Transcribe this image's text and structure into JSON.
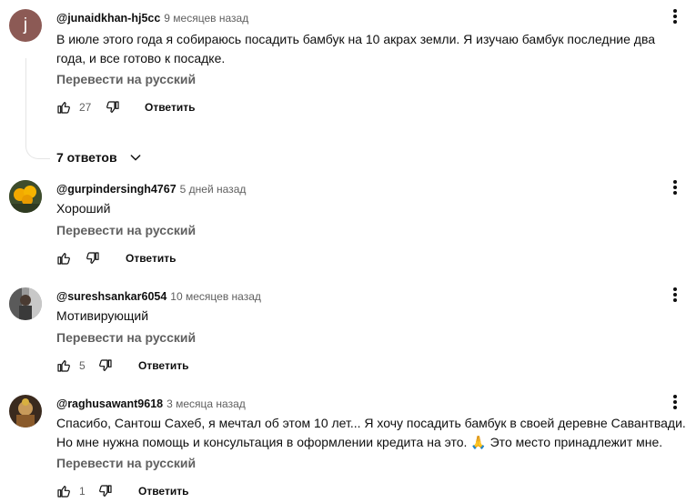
{
  "comments": [
    {
      "author": "@junaidkhan-hj5cc",
      "time": "9 месяцев назад",
      "avatar_letter": "j",
      "lines": [
        "В июле этого года я собираюсь посадить бамбук на 10 акрах земли. Я изучаю бамбук последние два",
        "года, и все готово к посадке."
      ],
      "translate": "Перевести на русский",
      "likes": "27",
      "reply": "Ответить",
      "replies_toggle": "7 ответов"
    },
    {
      "author": "@gurpindersingh4767",
      "time": "5 дней назад",
      "lines": [
        "Хороший"
      ],
      "translate": "Перевести на русский",
      "likes": "",
      "reply": "Ответить"
    },
    {
      "author": "@sureshsankar6054",
      "time": "10 месяцев назад",
      "lines": [
        "Мотивирующий"
      ],
      "translate": "Перевести на русский",
      "likes": "5",
      "reply": "Ответить"
    },
    {
      "author": "@raghusawant9618",
      "time": "3 месяца назад",
      "lines": [
        "Спасибо, Сантош Сахеб, я мечтал об этом 10 лет... Я хочу посадить бамбук в своей деревне Савантвади.",
        "Но мне нужна помощь и консультация в оформлении кредита на это. 🙏 Это место принадлежит мне."
      ],
      "translate": "Перевести на русский",
      "likes": "1",
      "reply": "Ответить"
    }
  ],
  "icons": {
    "like": "thumbs-up-icon",
    "dislike": "thumbs-down-icon",
    "menu": "more-vert-icon",
    "expand": "chevron-down-icon"
  },
  "colors": {
    "text": "#0f0f0f",
    "secondary": "#606060",
    "avatar_j": "#8c5a55"
  }
}
